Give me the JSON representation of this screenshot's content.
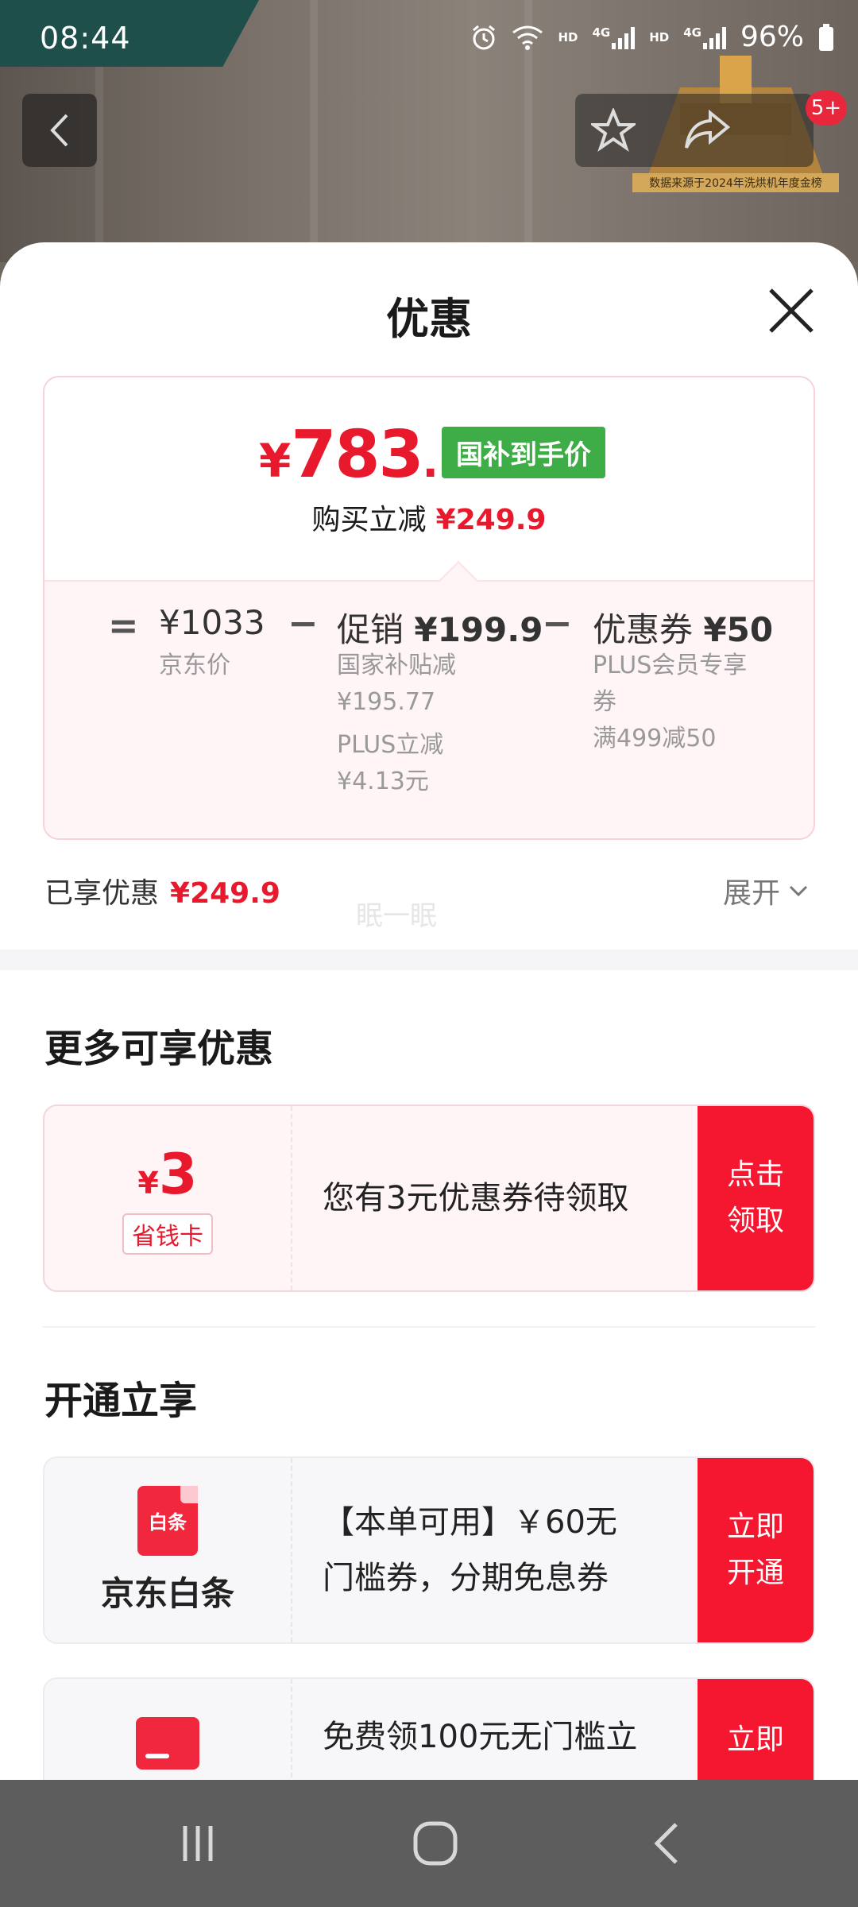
{
  "status_bar": {
    "time": "08:44",
    "net_hd_1": "HD",
    "net_4g_1": "4G",
    "net_hd_2": "HD",
    "net_4g_2": "4G",
    "battery": "96%"
  },
  "background": {
    "trophy_caption": "数据来源于2024年洗烘机年度金榜",
    "notification_count": "5+"
  },
  "sheet": {
    "title": "优惠",
    "price_card": {
      "final_price": {
        "currency": "¥",
        "integer": "783",
        "decimal": ".1"
      },
      "price_tag": "国补到手价",
      "reduce_label": "购买立减",
      "reduce_value": "¥249.9",
      "equals": "=",
      "minus": "−",
      "jd_price": {
        "value": "¥1033",
        "label": "京东价"
      },
      "promo": {
        "label": "促销",
        "value": "¥199.9",
        "detail_1_label": "国家补贴减",
        "detail_1_value": "¥195.77",
        "detail_2_label": "PLUS立减",
        "detail_2_value": "¥4.13元"
      },
      "coupon": {
        "label": "优惠券",
        "value": "¥50",
        "detail_1": "PLUS会员专享",
        "detail_1b": "券",
        "detail_2": "满499减50"
      }
    },
    "enjoyed_label": "已享优惠",
    "enjoyed_value": "¥249.9",
    "expand_label": "展开",
    "watermark": "眠一眠"
  },
  "more_offers": {
    "title": "更多可享优惠",
    "card": {
      "currency": "¥",
      "amount": "3",
      "tag": "省钱卡",
      "text": "您有3元优惠券待领取",
      "button_line1": "点击",
      "button_line2": "领取"
    }
  },
  "open_to_enjoy": {
    "title": "开通立享",
    "baitiao": {
      "icon_text": "白条",
      "name": "京东白条",
      "text_line1": "【本单可用】￥60无",
      "text_line2": "门槛券，分期免息券",
      "button_line1": "立即",
      "button_line2": "开通"
    },
    "card2": {
      "text_line1": "免费领100元无门槛立",
      "button_line1": "立即"
    }
  },
  "colors": {
    "accent_red": "#e8192c",
    "button_red": "#f5172f",
    "tag_green": "#3fad47"
  },
  "icons": [
    "back-icon",
    "star-icon",
    "share-icon",
    "close-icon",
    "chevron-down-icon",
    "recent-apps-icon",
    "home-icon",
    "nav-back-icon"
  ]
}
